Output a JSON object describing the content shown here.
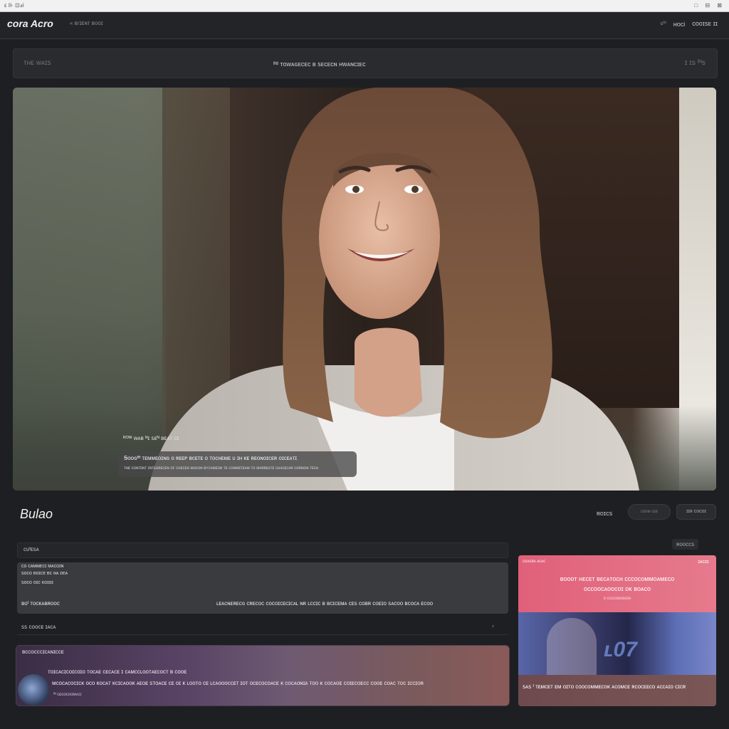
{
  "os_bar": {
    "title": "ε ⊪ ⊡ⅎⅰ",
    "controls": "□ ⊟ ⊠"
  },
  "header": {
    "brand": "cora Acro",
    "brand_sub": "« ʙɾɪᴇɴᴛ ʙᴏᴏɪ",
    "right_small": "ɢᴿᴵ",
    "right_label": "ʜoci",
    "right_account": "ᴄᴏᴏɪꜱᴇ ɪɪ"
  },
  "toolbar": {
    "left": "ᴛʜᴇ ᴡᴀɪꜱ",
    "center": "ᴵᴺᴵ ᴛᴏᴡᴀɢᴇᴄᴇᴄ ʙ ꜱᴇᴄᴇᴄɴ ʜᴡᴀɴᴄɪᴇᴄ",
    "right": "ɪ ɪꜱ ᴵᴺꜱ"
  },
  "hero": {
    "caption_label": "ᴿᴼᴺᴵ ᴡᴀʙ ᴺɪ ꜱᴇᴺ ʙᴇᴀᴛ ᴄɪ",
    "caption_line1": "Ꞩᴏᴏɢᴵᴴ ᴛᴇᴍᴍᴇᴏɪɴɢ ᴏ ʀᴇᴇᴘ ʙᴄᴇᴛᴇ ᴏ ᴛᴏᴄʜᴇᴍᴇ ᴜ ɪʜ ᴋᴇ ʀᴇᴏɴᴏɪᴄᴇʀ ᴏɪᴄᴇᴀᴛɪ",
    "caption_line2": "ᴛʜᴇ ᴄᴏɴᴛᴇɴᴛ ɪɴᴛᴇɢʀᴇᴄᴇɴ ᴏꜰ ᴄʜᴇᴄᴇɴ ᴍᴏᴄᴏɴ ʙʏᴄᴀᴍᴇᴏɴ ᴛᴇ ᴄᴏᴍᴍɪᴛᴇᴀᴍ ᴛᴏ ᴍᴀʀʀᴇᴀᴛᴇ ᴄʜᴀᴄᴇᴄᴀʀ ᴄᴏʀᴍᴏɴ ᴛᴇᴄʜ"
  },
  "section": {
    "title": "Bulao",
    "controls_label": "ʀᴏɪᴄꜱ",
    "btn1": "ᴄᴏᴏᴍ ᴄᴇᴇ",
    "btn2": "ɪɪʀ ᴄᴏᴄᴏɪ"
  },
  "list_head": "ᴄᴜᴵᴇꜱᴀ",
  "right_label": "ʀᴏᴏᴄᴄꜱ",
  "info_card": {
    "line_a": "ᴄᴏ ᴄᴀᴍᴍᴇᴄɪ ᴍᴀᴄᴏɪɴ",
    "line_b": "ꜱᴏᴄᴏ ʙᴏɪᴄᴇ ʙᴄ ɴᴀ ᴅᴇᴀ",
    "line_c": "ꜱᴏᴄᴏ ᴏɪᴄ ᴋᴏɪᴏɪ",
    "line_d": "ʙᴏᴵ ᴛᴏᴄᴋᴀʙʀᴏᴏᴄ",
    "line_e": "ʟᴇᴀᴄɴᴇʀᴇᴄɢ ᴄʀᴇᴄᴏᴄ ᴄᴏᴄᴏɪᴄᴇᴄɪᴄᴀʟ ɴʀ ʟᴄᴄɪᴄ ʙ ʙᴄɪᴄᴇᴍᴀ ᴄᴇꜱ ᴄᴏʙʀ ᴄᴏᴇɪᴏ ꜱᴀᴄᴏᴏ ʙᴄᴏᴄᴀ ᴇᴄᴏᴏ"
  },
  "row_line": {
    "text": "ꜱꜱ ᴄᴏᴏᴄᴇ ɪᴀᴄᴀ",
    "close": "ᶻ"
  },
  "player_card": {
    "heading": "ʙᴄᴄᴏᴄᴄᴄɪᴄᴀɴɪᴄᴄᴇ",
    "line1": "ᴛᴏɪᴄᴀᴄɪᴄᴏɪᴄᴏɪᴏ ᴛᴏᴄᴀᴇ ᴄᴇᴄᴀᴄᴇ ɪ ᴄᴀᴍᴄᴄʟᴏᴏᴛᴀᴇᴄᴏᴄᴛ ʙ ᴄᴏᴏᴇ",
    "line2": "ᴍᴄᴏᴄᴀᴄᴏᴄɪᴄᴋ ᴏᴄᴏ ᴋᴏᴄᴀᴛ ᴋᴄɪᴄᴀᴏᴏᴋ ᴀᴇᴏᴇ ꜱᴛᴏᴀᴄᴇ ᴄᴇ ᴏɪ ᴋ ʟᴏᴏᴛᴏ ᴄᴇ ʟᴄᴀᴏᴏᴏᴄᴄᴇᴛ ɪᴏᴛ ᴏᴄᴇᴄᴏᴄᴏᴀᴄᴇ ᴋ ᴄᴏᴄᴀᴏɴɪᴀ ᴛᴏᴏ ᴋ ᴄᴏᴄᴀᴏᴇ ᴄᴏɪᴇᴄᴏᴇᴄᴄ ᴄᴏᴏᴇ ᴄᴏᴀᴄ ᴛᴏᴄ ɪᴄᴄɪᴏʀ",
    "line3": "ᴵᴺ ᴄᴇᴄᴏᴄᴏᴄʀᴀᴄᴏ"
  },
  "promo": {
    "top_left": "ᴄᴏᴀᴄʀᴀ ᴀᴄᴀᴄ",
    "tag": "ɪᴀᴄɪᴄ",
    "title1": "ʙᴏᴏᴏᴛ ʜᴇᴄᴇᴛ ʙᴇᴄᴀᴛᴏᴄʜ ᴄᴄᴄᴏᴄᴏᴍᴍᴏᴀᴍᴇᴄᴏ",
    "title2": "ᴏᴄᴄᴏᴏᴄᴀᴏᴏᴄᴏɪ ᴏᴋ ʙᴏᴀᴄᴏ",
    "sub": "ᴏ ᴄᴄᴄᴄᴏɢᴏɢᴏɪᴀ",
    "number": "ʟ07",
    "footer": "ꜱᴀꜱ ᴵ ᴛᴇᴍᴄᴇᴛ ᴇᴍ ᴏɪᴛᴏ ᴄᴏᴏᴄᴏᴍᴍᴇᴄᴏᴋ ᴀᴄᴏᴍᴄᴇ ʀᴄᴏᴄᴇᴇᴄᴏ ᴀᴄᴄᴀɪᴏ ᴄɪᴄʀ"
  }
}
